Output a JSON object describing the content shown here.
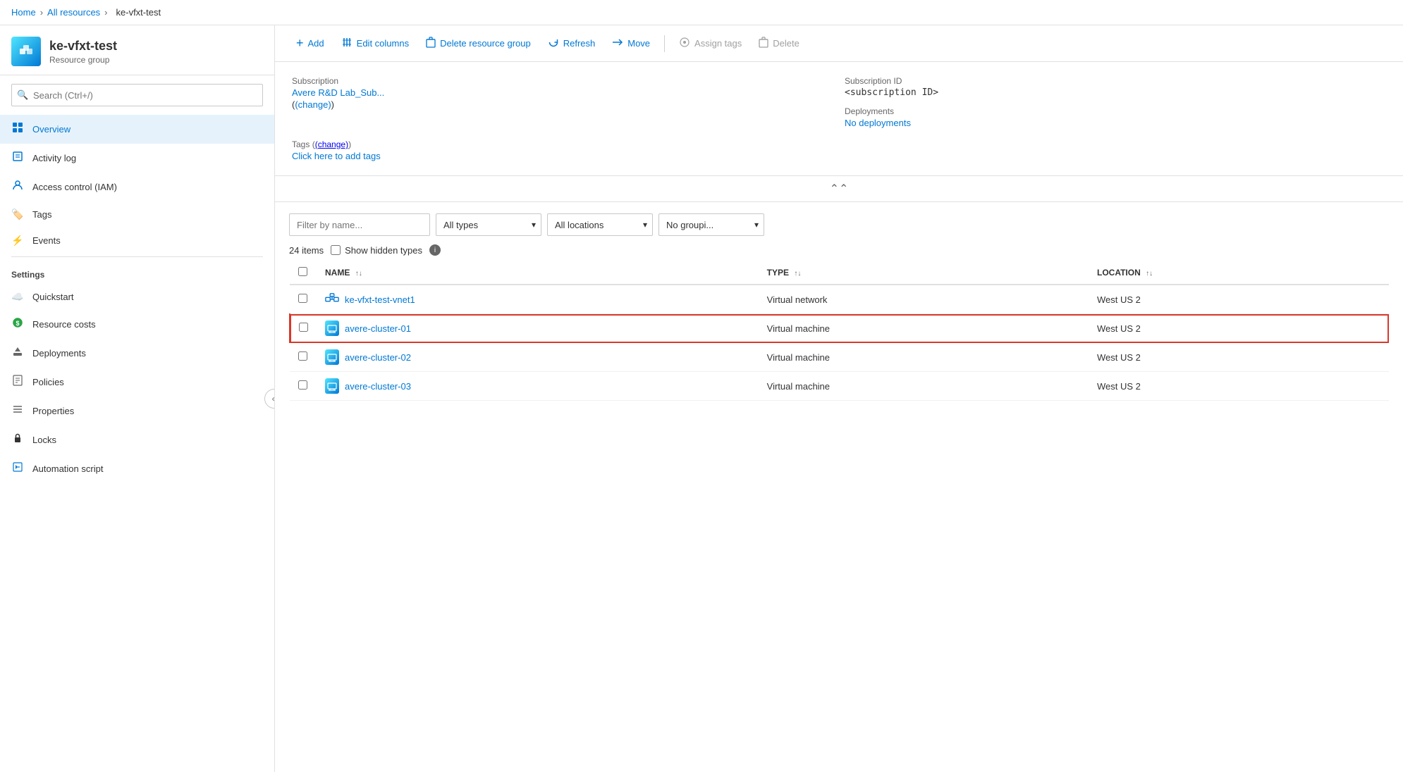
{
  "breadcrumb": {
    "home": "Home",
    "all_resources": "All resources",
    "current": "ke-vfxt-test"
  },
  "sidebar": {
    "resource_name": "ke-vfxt-test",
    "resource_type": "Resource group",
    "search_placeholder": "Search (Ctrl+/)",
    "nav_items": [
      {
        "id": "overview",
        "label": "Overview",
        "icon": "🗂️",
        "active": true
      },
      {
        "id": "activity-log",
        "label": "Activity log",
        "icon": "📋"
      },
      {
        "id": "access-control",
        "label": "Access control (IAM)",
        "icon": "👥"
      },
      {
        "id": "tags",
        "label": "Tags",
        "icon": "🏷️"
      },
      {
        "id": "events",
        "label": "Events",
        "icon": "⚡"
      }
    ],
    "settings_label": "Settings",
    "settings_items": [
      {
        "id": "quickstart",
        "label": "Quickstart",
        "icon": "☁️"
      },
      {
        "id": "resource-costs",
        "label": "Resource costs",
        "icon": "💚"
      },
      {
        "id": "deployments",
        "label": "Deployments",
        "icon": "⬆️"
      },
      {
        "id": "policies",
        "label": "Policies",
        "icon": "📄"
      },
      {
        "id": "properties",
        "label": "Properties",
        "icon": "☰"
      },
      {
        "id": "locks",
        "label": "Locks",
        "icon": "🔒"
      },
      {
        "id": "automation-script",
        "label": "Automation script",
        "icon": "💾"
      }
    ]
  },
  "toolbar": {
    "add_label": "Add",
    "edit_columns_label": "Edit columns",
    "delete_rg_label": "Delete resource group",
    "refresh_label": "Refresh",
    "move_label": "Move",
    "assign_tags_label": "Assign tags",
    "delete_label": "Delete"
  },
  "info": {
    "subscription_label": "Subscription",
    "subscription_change": "(change)",
    "subscription_value": "Avere R&D Lab_Sub...",
    "subscription_id_label": "Subscription ID",
    "subscription_id_value": "<subscription ID>",
    "deployments_label": "Deployments",
    "deployments_value": "No deployments",
    "tags_label": "Tags",
    "tags_change": "(change)",
    "tags_add": "Click here to add tags"
  },
  "resources": {
    "filter_placeholder": "Filter by name...",
    "all_types_label": "All types",
    "all_locations_label": "All locations",
    "no_grouping_label": "No groupi...",
    "items_count": "24 items",
    "show_hidden_label": "Show hidden types",
    "columns": [
      {
        "id": "name",
        "label": "NAME"
      },
      {
        "id": "type",
        "label": "TYPE"
      },
      {
        "id": "location",
        "label": "LOCATION"
      }
    ],
    "rows": [
      {
        "id": "vnet1",
        "name": "ke-vfxt-test-vnet1",
        "type": "Virtual network",
        "location": "West US 2",
        "icon": "vnet",
        "highlighted": false
      },
      {
        "id": "cluster01",
        "name": "avere-cluster-01",
        "type": "Virtual machine",
        "location": "West US 2",
        "icon": "vm",
        "highlighted": true
      },
      {
        "id": "cluster02",
        "name": "avere-cluster-02",
        "type": "Virtual machine",
        "location": "West US 2",
        "icon": "vm",
        "highlighted": false
      },
      {
        "id": "cluster03",
        "name": "avere-cluster-03",
        "type": "Virtual machine",
        "location": "West US 2",
        "icon": "vm",
        "highlighted": false
      }
    ]
  }
}
